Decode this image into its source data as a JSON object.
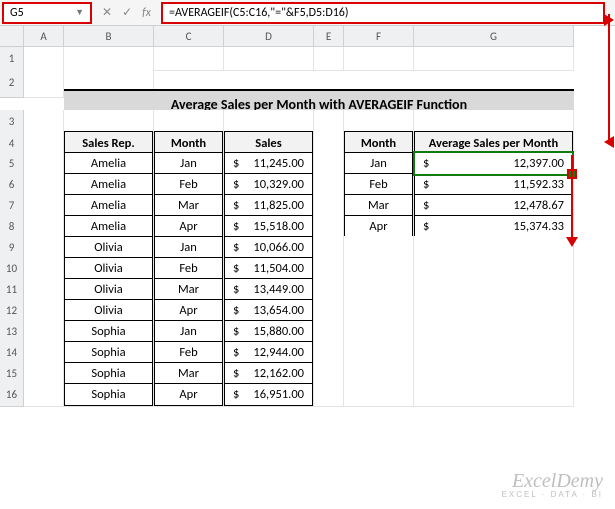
{
  "namebox": "G5",
  "formula": "=AVERAGEIF(C5:C16,\"=\"&F5,D5:D16)",
  "fx_label": "fx",
  "columns": [
    "A",
    "B",
    "C",
    "D",
    "E",
    "F",
    "G"
  ],
  "row_numbers": [
    "1",
    "2",
    "3",
    "4",
    "5",
    "6",
    "7",
    "8",
    "9",
    "10",
    "11",
    "12",
    "13",
    "14",
    "15",
    "16"
  ],
  "title": "Average Sales per Month with AVERAGEIF Function",
  "table1": {
    "headers": [
      "Sales Rep.",
      "Month",
      "Sales"
    ],
    "rows": [
      {
        "rep": "Amelia",
        "month": "Jan",
        "sales": "11,245.00"
      },
      {
        "rep": "Amelia",
        "month": "Feb",
        "sales": "10,329.00"
      },
      {
        "rep": "Amelia",
        "month": "Mar",
        "sales": "11,825.00"
      },
      {
        "rep": "Amelia",
        "month": "Apr",
        "sales": "15,518.00"
      },
      {
        "rep": "Olivia",
        "month": "Jan",
        "sales": "10,066.00"
      },
      {
        "rep": "Olivia",
        "month": "Feb",
        "sales": "11,504.00"
      },
      {
        "rep": "Olivia",
        "month": "Mar",
        "sales": "13,449.00"
      },
      {
        "rep": "Olivia",
        "month": "Apr",
        "sales": "13,654.00"
      },
      {
        "rep": "Sophia",
        "month": "Jan",
        "sales": "15,880.00"
      },
      {
        "rep": "Sophia",
        "month": "Feb",
        "sales": "12,944.00"
      },
      {
        "rep": "Sophia",
        "month": "Mar",
        "sales": "12,162.00"
      },
      {
        "rep": "Sophia",
        "month": "Apr",
        "sales": "16,951.00"
      }
    ]
  },
  "table2": {
    "headers": [
      "Month",
      "Average Sales per Month"
    ],
    "rows": [
      {
        "month": "Jan",
        "avg": "12,397.00"
      },
      {
        "month": "Feb",
        "avg": "11,592.33"
      },
      {
        "month": "Mar",
        "avg": "12,478.67"
      },
      {
        "month": "Apr",
        "avg": "15,374.33"
      }
    ]
  },
  "currency": "$",
  "watermark": {
    "brand": "ExcelDemy",
    "tag": "EXCEL · DATA · BI"
  }
}
